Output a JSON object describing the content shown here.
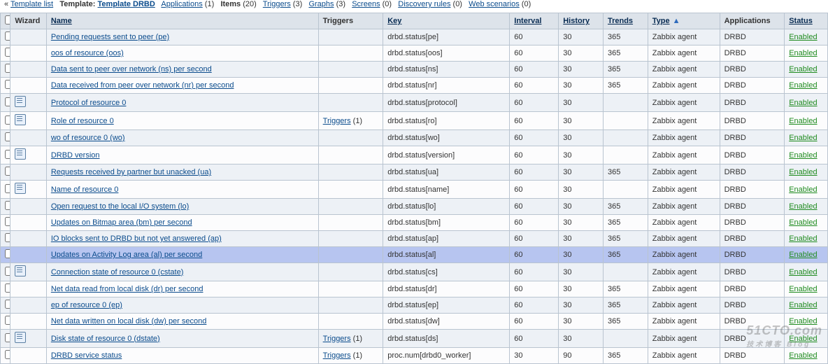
{
  "breadcrumb": {
    "template_list": "Template list",
    "template_label": "Template:",
    "template_name": "Template DRBD",
    "applications": "Applications",
    "applications_count": "(1)",
    "items": "Items",
    "items_count": "(20)",
    "triggers": "Triggers",
    "triggers_count": "(3)",
    "graphs": "Graphs",
    "graphs_count": "(3)",
    "screens": "Screens",
    "screens_count": "(0)",
    "discovery": "Discovery rules",
    "discovery_count": "(0)",
    "web": "Web scenarios",
    "web_count": "(0)"
  },
  "headers": {
    "wizard": "Wizard",
    "name": "Name",
    "triggers": "Triggers",
    "key": "Key",
    "interval": "Interval",
    "history": "History",
    "trends": "Trends",
    "type": "Type",
    "applications": "Applications",
    "status": "Status"
  },
  "triggers_label": "Triggers",
  "status_enabled": "Enabled",
  "rows": [
    {
      "wiz": false,
      "name": "Pending requests sent to peer (pe)",
      "trig": "",
      "key": "drbd.status[pe]",
      "int": "60",
      "hist": "30",
      "trend": "365",
      "type": "Zabbix agent",
      "app": "DRBD",
      "hl": false
    },
    {
      "wiz": false,
      "name": "oos of resource (oos)",
      "trig": "",
      "key": "drbd.status[oos]",
      "int": "60",
      "hist": "30",
      "trend": "365",
      "type": "Zabbix agent",
      "app": "DRBD",
      "hl": false
    },
    {
      "wiz": false,
      "name": "Data sent to peer over network (ns) per second",
      "trig": "",
      "key": "drbd.status[ns]",
      "int": "60",
      "hist": "30",
      "trend": "365",
      "type": "Zabbix agent",
      "app": "DRBD",
      "hl": false
    },
    {
      "wiz": false,
      "name": "Data received from peer over network (nr) per second",
      "trig": "",
      "key": "drbd.status[nr]",
      "int": "60",
      "hist": "30",
      "trend": "365",
      "type": "Zabbix agent",
      "app": "DRBD",
      "hl": false
    },
    {
      "wiz": true,
      "name": "Protocol of resource 0",
      "trig": "",
      "key": "drbd.status[protocol]",
      "int": "60",
      "hist": "30",
      "trend": "",
      "type": "Zabbix agent",
      "app": "DRBD",
      "hl": false
    },
    {
      "wiz": true,
      "name": "Role of resource 0",
      "trig": "(1)",
      "key": "drbd.status[ro]",
      "int": "60",
      "hist": "30",
      "trend": "",
      "type": "Zabbix agent",
      "app": "DRBD",
      "hl": false
    },
    {
      "wiz": false,
      "name": "wo of resource 0 (wo)",
      "trig": "",
      "key": "drbd.status[wo]",
      "int": "60",
      "hist": "30",
      "trend": "",
      "type": "Zabbix agent",
      "app": "DRBD",
      "hl": false
    },
    {
      "wiz": true,
      "name": "DRBD version",
      "trig": "",
      "key": "drbd.status[version]",
      "int": "60",
      "hist": "30",
      "trend": "",
      "type": "Zabbix agent",
      "app": "DRBD",
      "hl": false
    },
    {
      "wiz": false,
      "name": "Requests received by partner but unacked (ua)",
      "trig": "",
      "key": "drbd.status[ua]",
      "int": "60",
      "hist": "30",
      "trend": "365",
      "type": "Zabbix agent",
      "app": "DRBD",
      "hl": false
    },
    {
      "wiz": true,
      "name": "Name of resource 0",
      "trig": "",
      "key": "drbd.status[name]",
      "int": "60",
      "hist": "30",
      "trend": "",
      "type": "Zabbix agent",
      "app": "DRBD",
      "hl": false
    },
    {
      "wiz": false,
      "name": "Open request to the local I/O system (lo)",
      "trig": "",
      "key": "drbd.status[lo]",
      "int": "60",
      "hist": "30",
      "trend": "365",
      "type": "Zabbix agent",
      "app": "DRBD",
      "hl": false
    },
    {
      "wiz": false,
      "name": "Updates on Bitmap area (bm) per second",
      "trig": "",
      "key": "drbd.status[bm]",
      "int": "60",
      "hist": "30",
      "trend": "365",
      "type": "Zabbix agent",
      "app": "DRBD",
      "hl": false
    },
    {
      "wiz": false,
      "name": "IO blocks sent to DRBD but not yet answered (ap)",
      "trig": "",
      "key": "drbd.status[ap]",
      "int": "60",
      "hist": "30",
      "trend": "365",
      "type": "Zabbix agent",
      "app": "DRBD",
      "hl": false
    },
    {
      "wiz": false,
      "name": "Updates on Activity Log area (al) per second",
      "trig": "",
      "key": "drbd.status[al]",
      "int": "60",
      "hist": "30",
      "trend": "365",
      "type": "Zabbix agent",
      "app": "DRBD",
      "hl": true
    },
    {
      "wiz": true,
      "name": "Connection state of resource 0 (cstate)",
      "trig": "",
      "key": "drbd.status[cs]",
      "int": "60",
      "hist": "30",
      "trend": "",
      "type": "Zabbix agent",
      "app": "DRBD",
      "hl": false
    },
    {
      "wiz": false,
      "name": "Net data read from local disk (dr) per second",
      "trig": "",
      "key": "drbd.status[dr]",
      "int": "60",
      "hist": "30",
      "trend": "365",
      "type": "Zabbix agent",
      "app": "DRBD",
      "hl": false
    },
    {
      "wiz": false,
      "name": "ep of resource 0 (ep)",
      "trig": "",
      "key": "drbd.status[ep]",
      "int": "60",
      "hist": "30",
      "trend": "365",
      "type": "Zabbix agent",
      "app": "DRBD",
      "hl": false
    },
    {
      "wiz": false,
      "name": "Net data written on local disk (dw) per second",
      "trig": "",
      "key": "drbd.status[dw]",
      "int": "60",
      "hist": "30",
      "trend": "365",
      "type": "Zabbix agent",
      "app": "DRBD",
      "hl": false
    },
    {
      "wiz": true,
      "name": "Disk state of resource 0 (dstate)",
      "trig": "(1)",
      "key": "drbd.status[ds]",
      "int": "60",
      "hist": "30",
      "trend": "",
      "type": "Zabbix agent",
      "app": "DRBD",
      "hl": false
    },
    {
      "wiz": false,
      "name": "DRBD service status",
      "trig": "(1)",
      "key": "proc.num[drbd0_worker]",
      "int": "30",
      "hist": "90",
      "trend": "365",
      "type": "Zabbix agent",
      "app": "DRBD",
      "hl": false
    }
  ],
  "watermark": {
    "main": "51CTO.com",
    "sub": "技术博客 Blog"
  }
}
